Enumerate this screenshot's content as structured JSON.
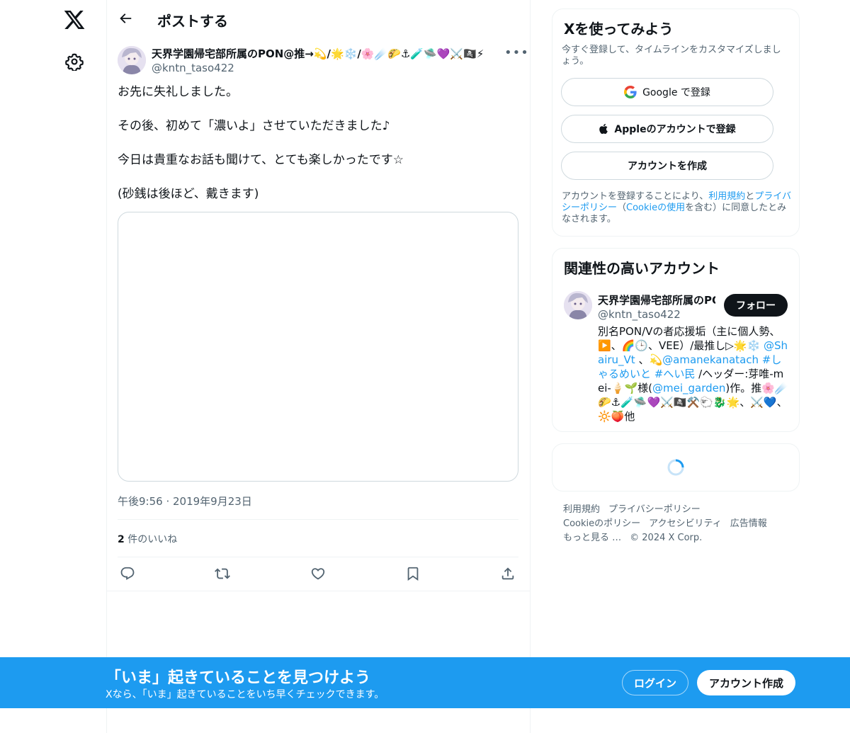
{
  "header": {
    "title": "ポストする"
  },
  "tweet": {
    "author_name": "天界学園帰宅部所属のPON@推→💫/🌟❄️/🌸☄️🌮⚓🧪🛸💜⚔️🏴‍☠️⚡",
    "author_handle": "@kntn_taso422",
    "text_lines": [
      "お先に失礼しました。",
      "その後、初めて「濃いよ」させていただきました♪",
      "今日は貴重なお話も聞けて、とても楽しかったです☆",
      "(砂銭は後ほど、戴きます)"
    ],
    "timestamp": "午後9:56 · 2019年9月23日",
    "likes_count": "2",
    "likes_label": " 件のいいね"
  },
  "signup_card": {
    "title": "Xを使ってみよう",
    "subtitle": "今すぐ登録して、タイムラインをカスタマイズしましょう。",
    "google_label": "Google で登録",
    "apple_label": "Appleのアカウントで登録",
    "create_label": "アカウントを作成",
    "legal_pre": "アカウントを登録することにより、",
    "legal_terms": "利用規約",
    "legal_and": "と",
    "legal_privacy": "プライバシーポリシー",
    "legal_paren_open": "（",
    "legal_cookie": "Cookieの使用",
    "legal_post": "を含む）に同意したとみなされます。"
  },
  "related_card": {
    "title": "関連性の高いアカウント",
    "account_name": "天界学園帰宅部所属のPON@推→",
    "account_handle": "@kntn_taso422",
    "follow_label": "フォロー",
    "bio_1": "別名PON/Vの者応援垢（主に個人勢、▶️、🌈🕒、VEE）/最推し▷🌟❄️ ",
    "bio_mention_1": "@Shairu_Vt",
    "bio_2": " 、💫",
    "bio_mention_2": "@amanekanatach",
    "bio_3": " ",
    "bio_tag_1": "#しゃるめいと",
    "bio_4": " ",
    "bio_tag_2": "#へい民",
    "bio_5": " /ヘッダー:芽唯-mei-🍦🌱様(",
    "bio_mention_3": "@mei_garden",
    "bio_6": ")作。推🌸☄️🌮⚓🧪🛸💜⚔️🏴‍☠️⚒️🐑🐉🌟、⚔️💙、🔆🍑他"
  },
  "footer": {
    "links": [
      "利用規約",
      "プライバシーポリシー",
      "Cookieのポリシー",
      "アクセシビリティ",
      "広告情報",
      "もっと見る …",
      "© 2024 X Corp."
    ]
  },
  "banner": {
    "title": "「いま」起きていることを見つけよう",
    "subtitle": "Xなら、「いま」起きていることをいち早くチェックできます。",
    "login_label": "ログイン",
    "signup_label": "アカウント作成"
  },
  "colors": {
    "accent": "#1d9bf0",
    "text": "#0f1419",
    "muted": "#536471"
  }
}
